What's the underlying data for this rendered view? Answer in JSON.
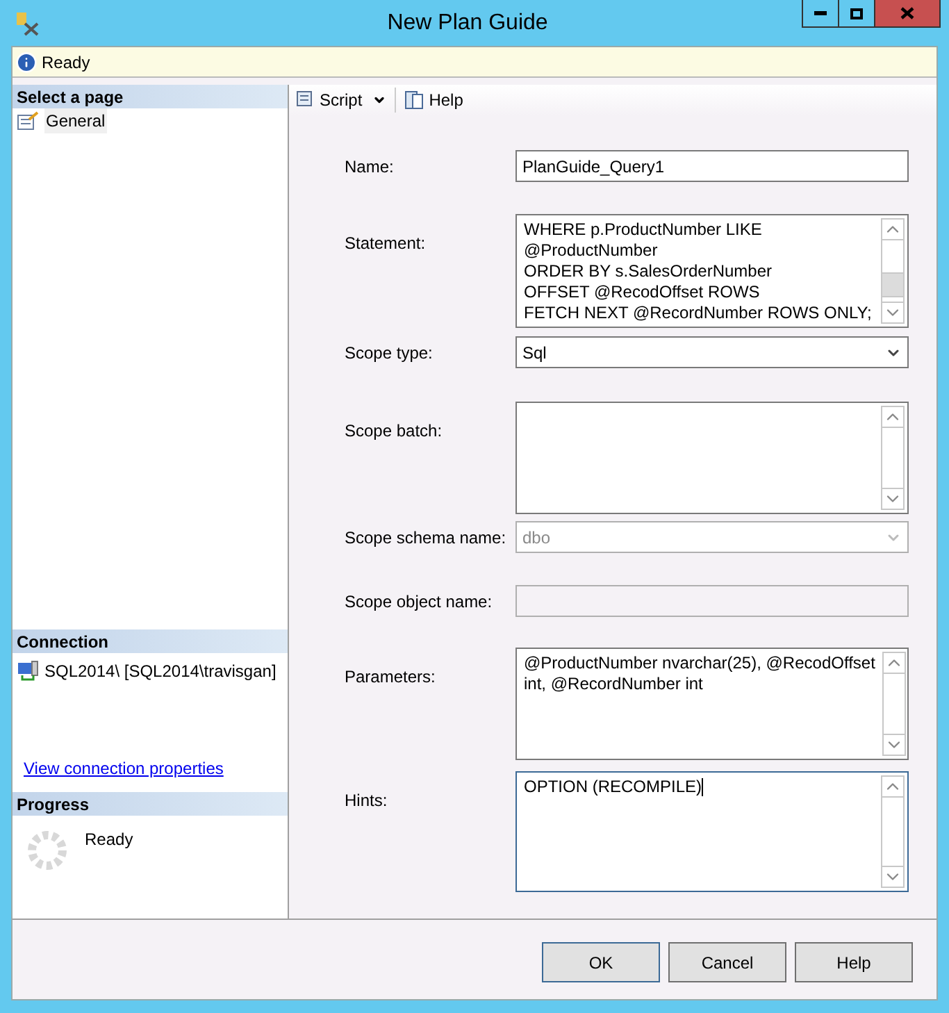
{
  "window": {
    "title": "New Plan Guide"
  },
  "status": {
    "text": "Ready"
  },
  "sidebar": {
    "header": "Select a page",
    "items": [
      {
        "label": "General",
        "selected": true
      }
    ]
  },
  "connection": {
    "header": "Connection",
    "server": "SQL2014\\ [SQL2014\\travisgan]",
    "link": "View connection properties"
  },
  "progress": {
    "header": "Progress",
    "text": "Ready"
  },
  "toolbar": [
    {
      "label": "Script",
      "kind": "script"
    },
    {
      "label": "Help",
      "kind": "help"
    }
  ],
  "fields": [
    {
      "label": "Name:",
      "kind": "text",
      "value": "PlanGuide_Query1",
      "disabled": false,
      "focused": false
    },
    {
      "label": "Statement:",
      "kind": "textarea",
      "lines": [
        "WHERE p.ProductNumber LIKE",
        "@ProductNumber",
        "ORDER BY s.SalesOrderNumber",
        "OFFSET @RecodOffset ROWS",
        "FETCH NEXT @RecordNumber ROWS ONLY;"
      ],
      "disabled": false,
      "focused": false
    },
    {
      "label": "Scope type:",
      "kind": "select",
      "value": "Sql",
      "disabled": false,
      "focused": false
    },
    {
      "label": "Scope batch:",
      "kind": "textarea",
      "disabled": false,
      "focused": false
    },
    {
      "label": "Scope schema name:",
      "kind": "select",
      "value": "dbo",
      "disabled": true,
      "focused": false
    },
    {
      "label": "Scope object name:",
      "kind": "text",
      "disabled": true,
      "focused": false
    },
    {
      "label": "Parameters:",
      "kind": "textarea",
      "lines": [
        "@ProductNumber nvarchar(25), @RecodOffset",
        "int, @RecordNumber int"
      ],
      "disabled": false,
      "focused": false
    },
    {
      "label": "Hints:",
      "kind": "textarea",
      "lines": [
        "OPTION (RECOMPILE)"
      ],
      "disabled": false,
      "focused": true
    }
  ],
  "buttons": [
    {
      "label": "OK",
      "default": true
    },
    {
      "label": "Cancel",
      "default": false
    },
    {
      "label": "Help",
      "default": false
    }
  ]
}
